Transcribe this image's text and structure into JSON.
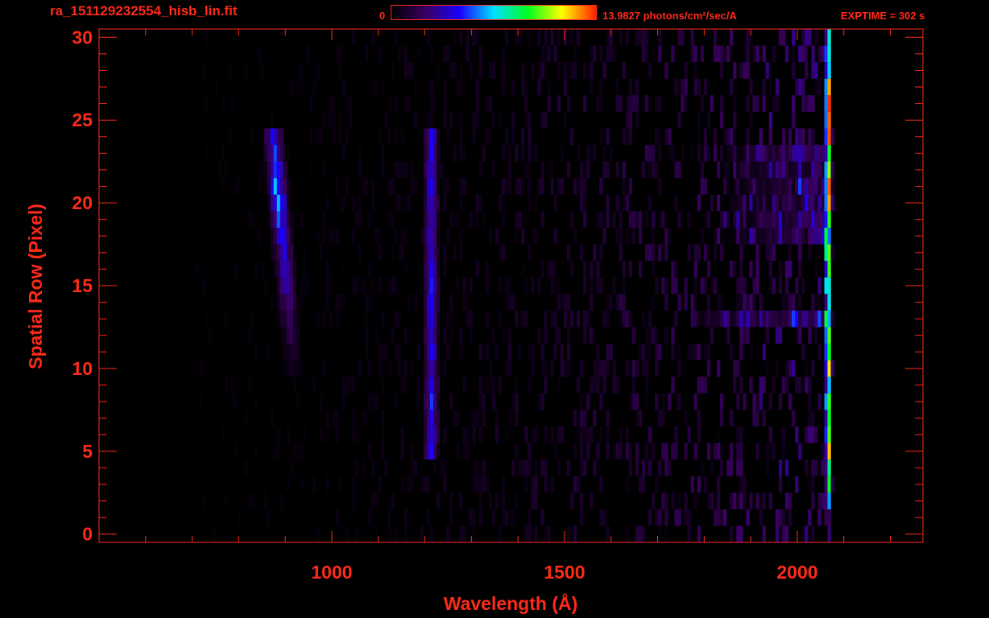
{
  "header": {
    "filename": "ra_151129232554_hisb_lin.fit",
    "colorbar_min": "0",
    "colorbar_max_text": "13.9827 photons/cm²/sec/A",
    "exptime": "EXPTIME = 302 s"
  },
  "colors": {
    "axis": "#ff2a1a",
    "background": "#000000",
    "colormap": [
      "#000000",
      "#3a0060",
      "#1a00ff",
      "#00e0ff",
      "#00ff20",
      "#ffff00",
      "#ff2000"
    ]
  },
  "chart_data": {
    "type": "heatmap",
    "xlabel": "Wavelength (Å)",
    "ylabel": "Spatial Row (Pixel)",
    "xlim": [
      500,
      2270
    ],
    "ylim": [
      -0.5,
      30.5
    ],
    "xticks": [
      1000,
      1500,
      2000
    ],
    "yticks": [
      0,
      5,
      10,
      15,
      20,
      25,
      30
    ],
    "colorbar_range": [
      0,
      13.9827
    ],
    "colorbar_units": "photons/cm²/sec/A",
    "features": [
      {
        "kind": "arc",
        "x_range": [
          860,
          900
        ],
        "rows": [
          10,
          24
        ],
        "peak_row": 21,
        "peak_value": 8.5
      },
      {
        "kind": "line",
        "x": 1210,
        "rows": [
          5,
          24
        ],
        "peak_value": 5.5
      },
      {
        "kind": "band",
        "x_range": [
          1750,
          2060
        ],
        "rows": [
          13,
          13
        ],
        "peak_value": 5.0
      },
      {
        "kind": "band",
        "x_range": [
          1800,
          2060
        ],
        "rows": [
          18,
          23
        ],
        "peak_value": 3.0
      },
      {
        "kind": "edge",
        "x": 2065,
        "rows": [
          2,
          30
        ],
        "peak_value": 13.9
      }
    ]
  }
}
